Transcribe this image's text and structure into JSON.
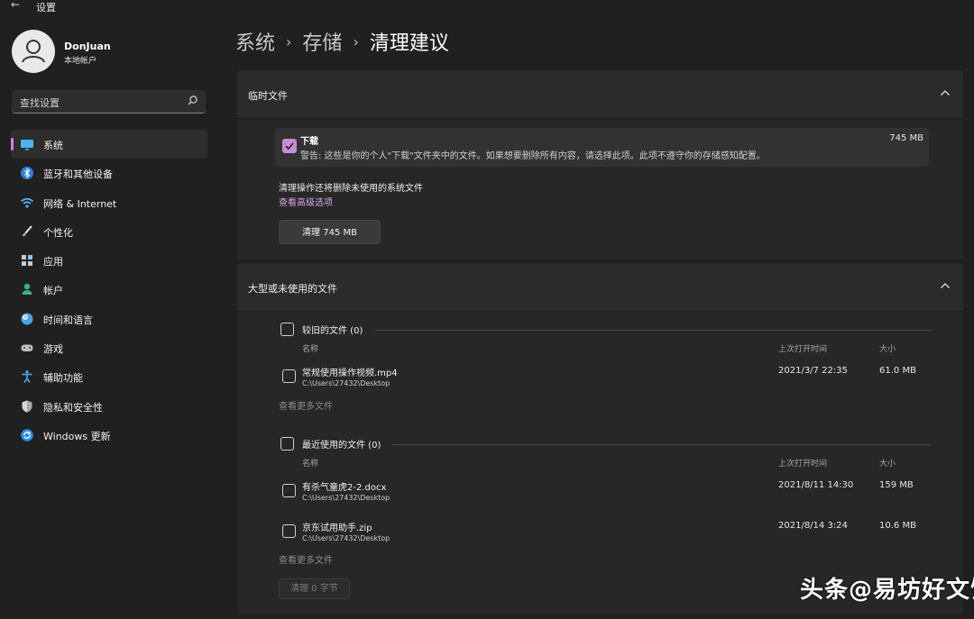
{
  "window": {
    "title": "设置"
  },
  "profile": {
    "name": "DonJuan",
    "account_type": "本地帐户"
  },
  "search": {
    "placeholder": "查找设置"
  },
  "nav": [
    {
      "label": "系统",
      "icon": "monitor-icon",
      "active": true
    },
    {
      "label": "蓝牙和其他设备",
      "icon": "bluetooth-icon"
    },
    {
      "label": "网络 & Internet",
      "icon": "wifi-icon"
    },
    {
      "label": "个性化",
      "icon": "brush-icon"
    },
    {
      "label": "应用",
      "icon": "apps-icon"
    },
    {
      "label": "帐户",
      "icon": "person-icon"
    },
    {
      "label": "时间和语言",
      "icon": "globe-clock-icon"
    },
    {
      "label": "游戏",
      "icon": "gamepad-icon"
    },
    {
      "label": "辅助功能",
      "icon": "accessibility-icon"
    },
    {
      "label": "隐私和安全性",
      "icon": "shield-icon"
    },
    {
      "label": "Windows 更新",
      "icon": "update-icon"
    }
  ],
  "breadcrumb": [
    "系统",
    "存储",
    "清理建议"
  ],
  "temp_files": {
    "title": "临时文件",
    "downloads": {
      "name": "下载",
      "warning": "警告: 这些是你的个人\"下载\"文件夹中的文件。如果想要删除所有内容，请选择此项。此项不遵守你的存储感知配置。",
      "size": "745 MB",
      "checked": true
    },
    "system_note": "清理操作还将删除未使用的系统文件",
    "advanced_link": "查看高级选项",
    "clean_button": "清理 745 MB"
  },
  "large_files": {
    "title": "大型或未使用的文件",
    "groups": [
      {
        "label": "较旧的文件 (0)",
        "columns": {
          "name": "名称",
          "opened": "上次打开时间",
          "size": "大小"
        },
        "files": [
          {
            "name": "常规使用操作视频.mp4",
            "path": "C:\\Users\\27432\\Desktop",
            "opened": "2021/3/7 22:35",
            "size": "61.0 MB"
          }
        ],
        "more": "查看更多文件"
      },
      {
        "label": "最近使用的文件 (0)",
        "columns": {
          "name": "名称",
          "opened": "上次打开时间",
          "size": "大小"
        },
        "files": [
          {
            "name": "有杀气童虎2-2.docx",
            "path": "C:\\Users\\27432\\Desktop",
            "opened": "2021/8/11 14:30",
            "size": "159 MB"
          },
          {
            "name": "京东试用助手.zip",
            "path": "C:\\Users\\27432\\Desktop",
            "opened": "2021/8/14 3:24",
            "size": "10.6 MB"
          }
        ],
        "more": "查看更多文件"
      }
    ],
    "clean_button": "清理 0 字节"
  },
  "watermark": "头条@易坊好文馆",
  "colors": {
    "accent": "#c78cd6",
    "background": "#202020",
    "card": "#2b2b2b"
  }
}
